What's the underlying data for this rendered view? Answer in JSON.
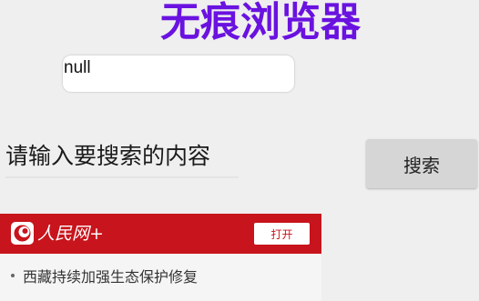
{
  "app": {
    "title": "无痕浏览器"
  },
  "url_field": {
    "value": "null"
  },
  "search": {
    "placeholder": "请输入要搜索的内容",
    "button_label": "搜索"
  },
  "webview": {
    "brand": "人民网+",
    "open_label": "打开",
    "news": [
      {
        "title": "西藏持续加强生态保护修复"
      }
    ]
  },
  "colors": {
    "title": "#6a12e0",
    "brand_bar": "#c8141c",
    "button_bg": "#d6d6d6",
    "background": "#efefef"
  }
}
